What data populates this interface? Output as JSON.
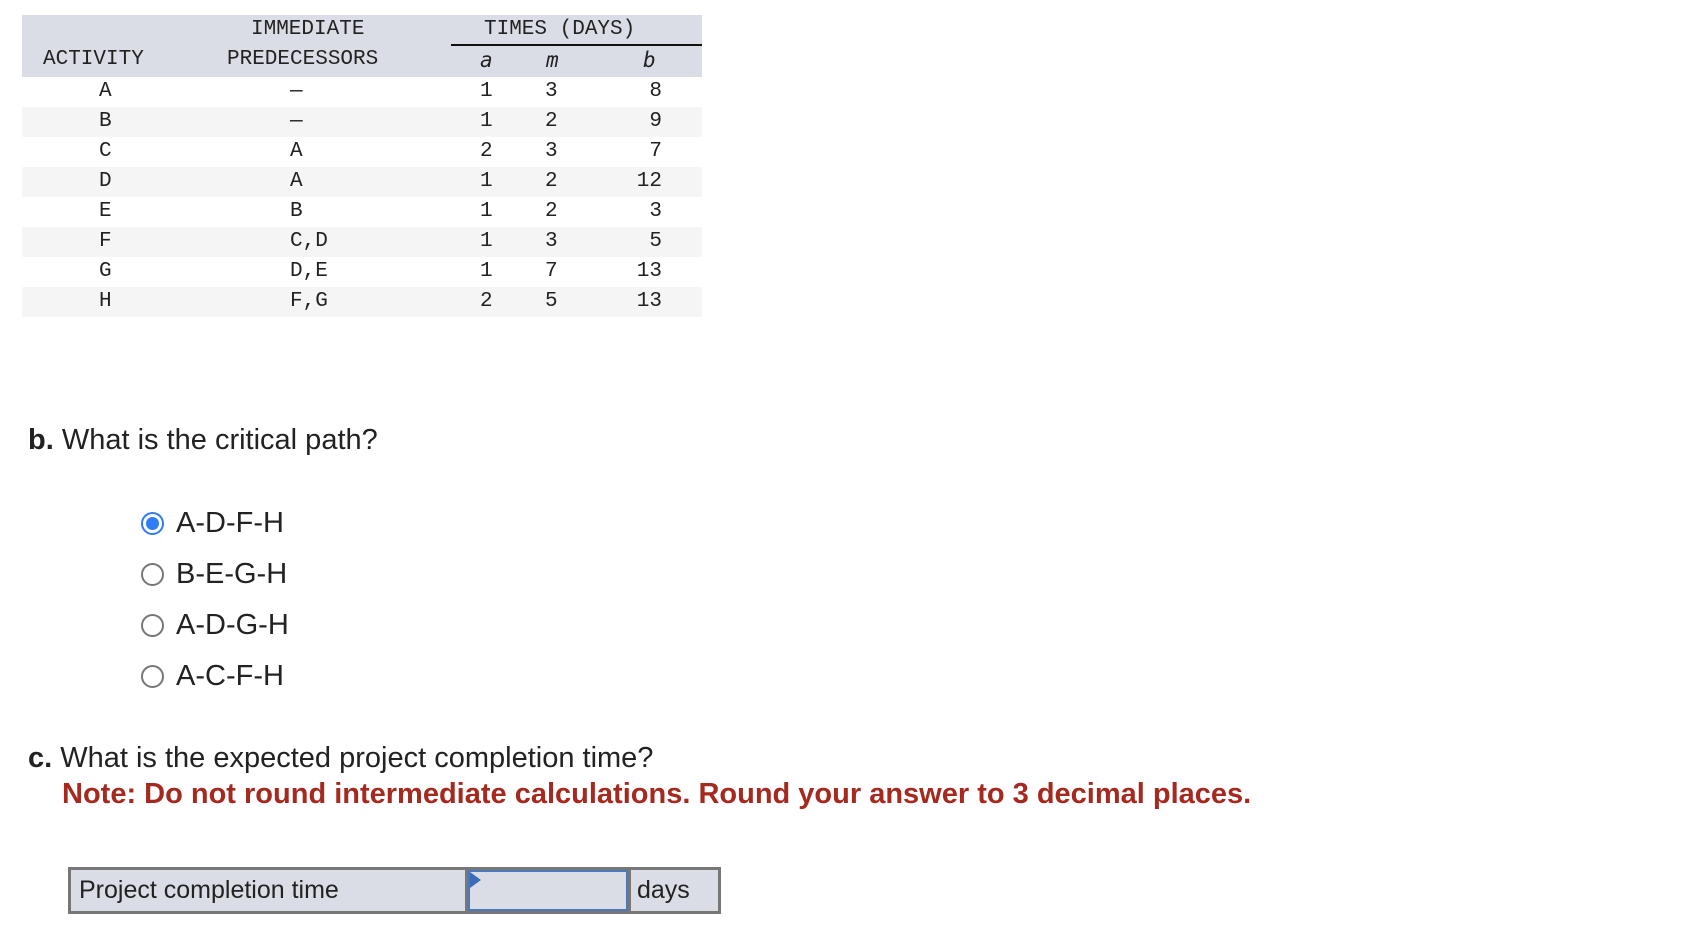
{
  "table": {
    "headers": {
      "activity": "ACTIVITY",
      "immediate_line1": "IMMEDIATE",
      "immediate_line2": "PREDECESSORS",
      "times_group": "TIMES (DAYS)",
      "a": "a",
      "m": "m",
      "b": "b"
    },
    "rows": [
      {
        "activity": "A",
        "predecessors": "—",
        "a": "1",
        "m": "3",
        "b": "8"
      },
      {
        "activity": "B",
        "predecessors": "—",
        "a": "1",
        "m": "2",
        "b": "9"
      },
      {
        "activity": "C",
        "predecessors": "A",
        "a": "2",
        "m": "3",
        "b": "7"
      },
      {
        "activity": "D",
        "predecessors": "A",
        "a": "1",
        "m": "2",
        "b": "12"
      },
      {
        "activity": "E",
        "predecessors": "B",
        "a": "1",
        "m": "2",
        "b": "3"
      },
      {
        "activity": "F",
        "predecessors": "C,D",
        "a": "1",
        "m": "3",
        "b": "5"
      },
      {
        "activity": "G",
        "predecessors": "D,E",
        "a": "1",
        "m": "7",
        "b": "13"
      },
      {
        "activity": "H",
        "predecessors": "F,G",
        "a": "2",
        "m": "5",
        "b": "13"
      }
    ]
  },
  "question_b": {
    "prefix": "b.",
    "text": "What is the critical path?",
    "options": [
      {
        "label": "A-D-F-H",
        "selected": true
      },
      {
        "label": "B-E-G-H",
        "selected": false
      },
      {
        "label": "A-D-G-H",
        "selected": false
      },
      {
        "label": "A-C-F-H",
        "selected": false
      }
    ]
  },
  "question_c": {
    "prefix": "c.",
    "text": "What is the expected project completion time?",
    "note": "Note: Do not round intermediate calculations. Round your answer to 3 decimal places.",
    "answer_row": {
      "label": "Project completion time",
      "value": "",
      "unit": "days"
    }
  },
  "colors": {
    "header_bg": "#dadde6",
    "stripe_bg": "#f5f5f5",
    "radio_selected": "#2f7cf6",
    "note_red": "#a5291f",
    "input_border": "#4a78b8"
  }
}
